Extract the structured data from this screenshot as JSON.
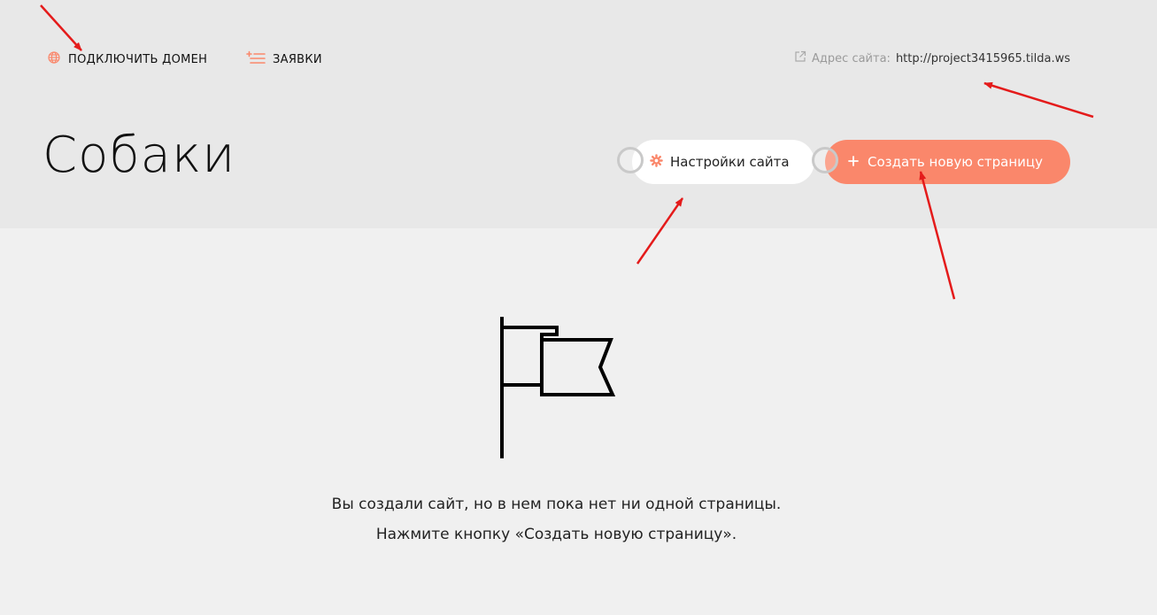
{
  "header": {
    "connect_domain_label": "ПОДКЛЮЧИТЬ ДОМЕН",
    "requests_label": "ЗАЯВКИ",
    "site_address_label": "Адрес сайта:",
    "site_address_url": "http://project3415965.tilda.ws",
    "site_title": "Собаки",
    "settings_label": "Настройки сайта",
    "create_page_label": "Создать новую страницу"
  },
  "empty_state": {
    "line1": "Вы создали сайт, но в нем пока нет ни одной страницы.",
    "line2": "Нажмите кнопку «Создать новую страницу»."
  },
  "colors": {
    "accent": "#fa876b",
    "annotation_arrow": "#e41b1b",
    "header_bg": "#e8e8e8",
    "page_bg": "#f0f0f0"
  },
  "icons": {
    "domain": "globe-icon",
    "requests": "list-plus-icon",
    "address": "external-link-icon",
    "settings": "gear-icon",
    "create": "plus-icon",
    "illustration": "flag-icon"
  }
}
